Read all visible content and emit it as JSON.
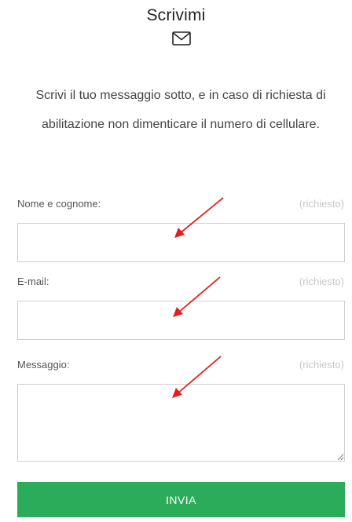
{
  "header": {
    "title": "Scrivimi",
    "icon": "envelope-icon"
  },
  "intro": {
    "text": "Scrivi il tuo messaggio sotto, e in caso di richiesta di abilitazione non dimenticare il numero di cellulare."
  },
  "form": {
    "fields": [
      {
        "label": "Nome e cognome:",
        "required_text": "(richiesto)",
        "value": ""
      },
      {
        "label": "E-mail:",
        "required_text": "(richiesto)",
        "value": ""
      },
      {
        "label": "Messaggio:",
        "required_text": "(richiesto)",
        "value": ""
      }
    ],
    "submit_label": "INVIA"
  },
  "colors": {
    "button": "#2aac5b",
    "arrow": "#e02020",
    "required": "#c8c8c8"
  },
  "annotations": [
    "arrow-icon",
    "arrow-icon",
    "arrow-icon"
  ]
}
